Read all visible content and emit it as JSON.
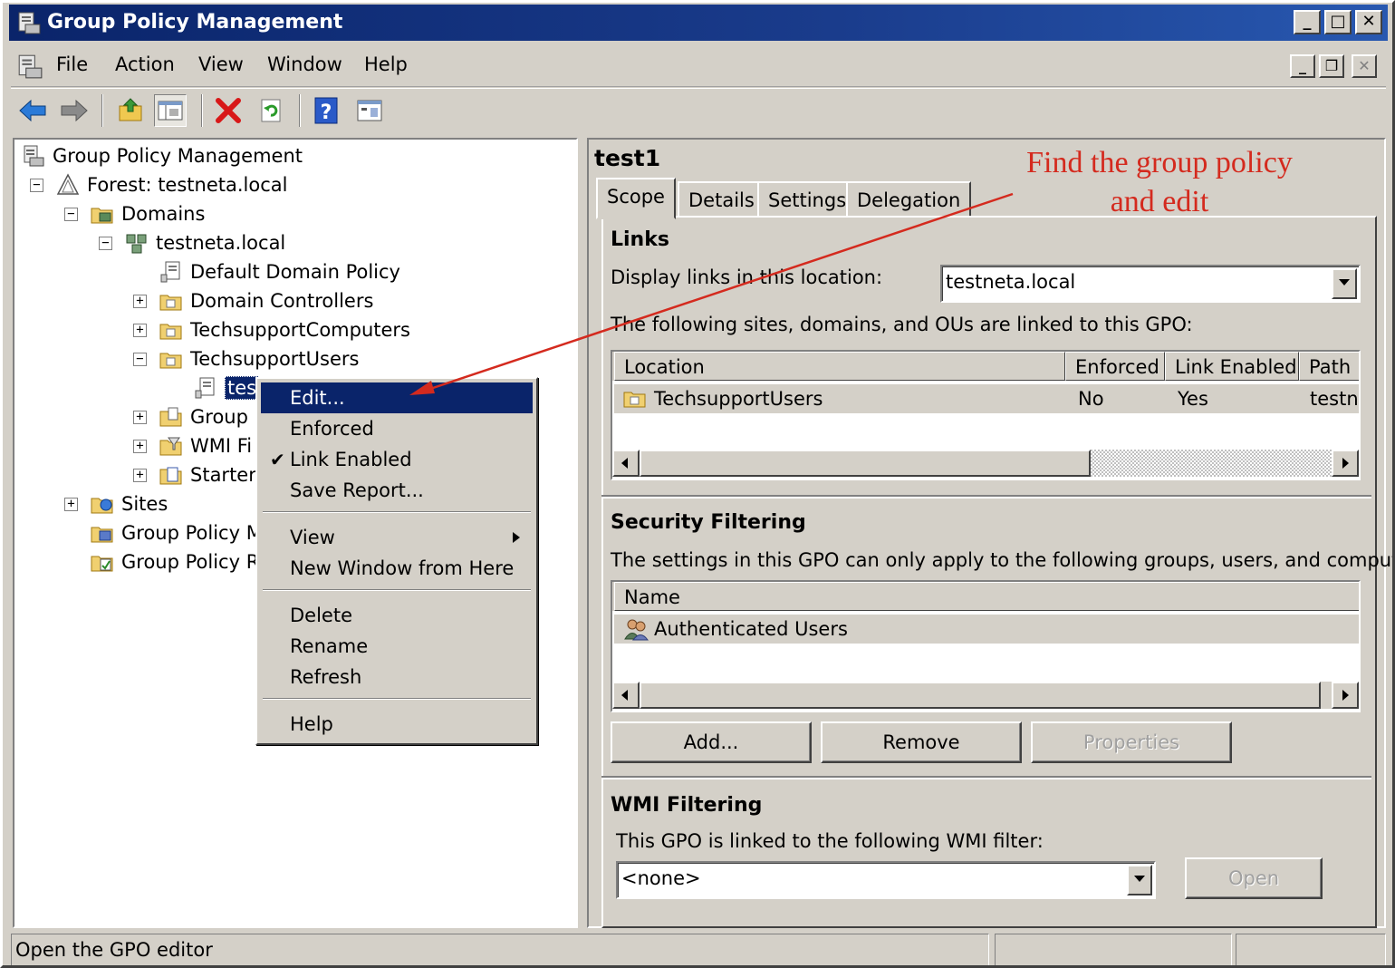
{
  "window": {
    "title": "Group Policy Management",
    "min_label": "_",
    "max_label": "□",
    "close_label": "✕",
    "mdi_min_label": "_",
    "mdi_restore_label": "❐",
    "mdi_close_label": "✕"
  },
  "menubar": {
    "items": [
      "File",
      "Action",
      "View",
      "Window",
      "Help"
    ]
  },
  "toolbar": {
    "buttons": [
      "back-arrow-icon",
      "forward-arrow-icon",
      "up-folder-icon",
      "show-hide-tree-icon",
      "delete-x-icon",
      "refresh-icon",
      "help-icon",
      "export-list-icon"
    ]
  },
  "tree": {
    "nodes": [
      {
        "label": "Group Policy Management",
        "icon": "gpm-console-icon"
      },
      {
        "label": "Forest: testneta.local",
        "icon": "forest-icon",
        "expander": "−"
      },
      {
        "label": "Domains",
        "icon": "domains-folder-icon",
        "expander": "−"
      },
      {
        "label": "testneta.local",
        "icon": "domain-icon",
        "expander": "−"
      },
      {
        "label": "Default Domain Policy",
        "icon": "gpo-link-icon"
      },
      {
        "label": "Domain Controllers",
        "icon": "ou-folder-icon",
        "expander": "+"
      },
      {
        "label": "TechsupportComputers",
        "icon": "ou-folder-icon",
        "expander": "+"
      },
      {
        "label": "TechsupportUsers",
        "icon": "ou-folder-icon",
        "expander": "−"
      },
      {
        "label": "tes",
        "icon": "gpo-link-icon"
      },
      {
        "label": "Group",
        "icon": "gpo-folder-icon",
        "expander": "+"
      },
      {
        "label": "WMI Fi",
        "icon": "wmi-folder-icon",
        "expander": "+"
      },
      {
        "label": "Starter",
        "icon": "starter-gpo-icon",
        "expander": "+"
      },
      {
        "label": "Sites",
        "icon": "sites-icon",
        "expander": "+"
      },
      {
        "label": "Group Policy M",
        "icon": "modeling-icon"
      },
      {
        "label": "Group Policy Re",
        "icon": "results-icon"
      }
    ]
  },
  "context_menu": {
    "items": {
      "edit": "Edit...",
      "enforced": "Enforced",
      "link_enabled": "Link Enabled",
      "save_report": "Save Report...",
      "view": "View",
      "new_window": "New Window from Here",
      "delete": "Delete",
      "rename": "Rename",
      "refresh": "Refresh",
      "help": "Help"
    },
    "link_enabled_checked": true,
    "check_mark": "✔"
  },
  "details": {
    "title": "test1",
    "tabs": [
      "Scope",
      "Details",
      "Settings",
      "Delegation"
    ],
    "active_tab": "Scope",
    "links": {
      "heading": "Links",
      "display_label": "Display links in this location:",
      "location_value": "testneta.local",
      "linked_text": "The following sites, domains, and OUs are linked to this GPO:",
      "columns": [
        "Location",
        "Enforced",
        "Link Enabled",
        "Path"
      ],
      "rows": [
        {
          "location": "TechsupportUsers",
          "enforced": "No",
          "link_enabled": "Yes",
          "path": "testne"
        }
      ]
    },
    "security": {
      "heading": "Security Filtering",
      "desc": "The settings in this GPO can only apply to the following groups, users, and computers:",
      "columns": [
        "Name"
      ],
      "rows": [
        {
          "name": "Authenticated Users"
        }
      ],
      "add_label": "Add...",
      "remove_label": "Remove",
      "properties_label": "Properties"
    },
    "wmi": {
      "heading": "WMI Filtering",
      "desc": "This GPO is linked to the following WMI filter:",
      "filter_value": "<none>",
      "open_label": "Open"
    }
  },
  "status": {
    "text": "Open the GPO editor"
  },
  "annotation": {
    "line1": "Find the group policy",
    "line2": "and edit"
  },
  "colors": {
    "selection": "#0a246a",
    "annotation": "#d42a1e",
    "face": "#d4d0c8"
  }
}
